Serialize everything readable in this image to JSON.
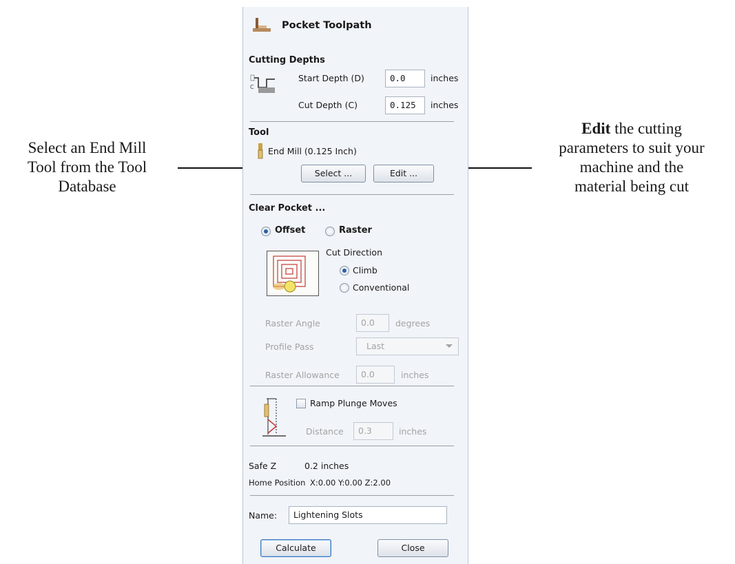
{
  "annotations": {
    "left": [
      "Select an End Mill",
      "Tool from the Tool",
      "Database"
    ],
    "right_bold": "Edit",
    "right_first": "the cutting",
    "right_rest": [
      "parameters to suit your",
      "machine and the",
      "material being cut"
    ]
  },
  "panel": {
    "title": "Pocket Toolpath",
    "cutting_depths": {
      "heading": "Cutting Depths",
      "start_label": "Start Depth (D)",
      "start_value": "0.0",
      "cut_label": "Cut Depth (C)",
      "cut_value": "0.125",
      "unit": "inches"
    },
    "tool": {
      "heading": "Tool",
      "name": "End Mill (0.125 Inch)",
      "select_label": "Select ...",
      "edit_label": "Edit ..."
    },
    "clear_pocket": {
      "heading": "Clear Pocket ...",
      "offset_label": "Offset",
      "raster_label": "Raster",
      "selected": "Offset",
      "cut_direction_label": "Cut Direction",
      "climb_label": "Climb",
      "conventional_label": "Conventional",
      "direction": "Climb",
      "raster_angle_label": "Raster Angle",
      "raster_angle_value": "0.0",
      "raster_angle_unit": "degrees",
      "profile_pass_label": "Profile Pass",
      "profile_pass_value": "Last",
      "raster_allowance_label": "Raster Allowance",
      "raster_allowance_value": "0.0",
      "raster_allowance_unit": "inches"
    },
    "ramp": {
      "label": "Ramp Plunge Moves",
      "checked": false,
      "distance_label": "Distance",
      "distance_value": "0.3",
      "distance_unit": "inches"
    },
    "safe_z": {
      "label": "Safe Z",
      "value": "0.2 inches"
    },
    "home": {
      "label": "Home Position",
      "value": "X:0.00 Y:0.00 Z:2.00"
    },
    "name": {
      "label": "Name:",
      "value": "Lightening Slots"
    },
    "buttons": {
      "calculate": "Calculate",
      "close": "Close"
    }
  }
}
